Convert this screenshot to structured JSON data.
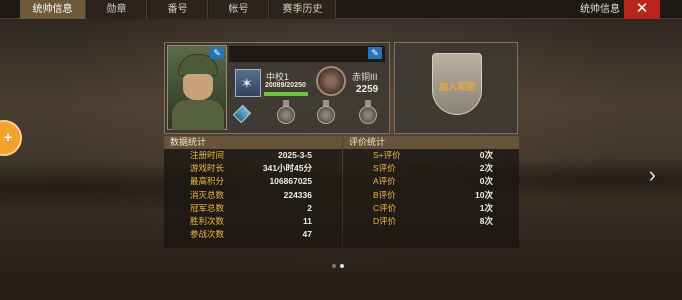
{
  "tabs": [
    {
      "label": "统帅信息",
      "active": true
    },
    {
      "label": "勋章",
      "active": false
    },
    {
      "label": "番号",
      "active": false
    },
    {
      "label": "帐号",
      "active": false
    },
    {
      "label": "赛季历史",
      "active": false
    }
  ],
  "header": {
    "title": "统帅信息",
    "close_icon": "close-icon"
  },
  "profile": {
    "rank": {
      "name": "中校1",
      "exp_text": "20089/20250",
      "exp_fraction": 0.992
    },
    "tier": {
      "name": "赤铜III",
      "score": "2259"
    }
  },
  "emblem": {
    "label": "加入军团"
  },
  "stats": {
    "title": "数据统计",
    "rows": [
      {
        "label": "注册时间",
        "value": "2025-3-5"
      },
      {
        "label": "游戏时长",
        "value": "341小时45分"
      },
      {
        "label": "最高积分",
        "value": "106867025"
      },
      {
        "label": "消灭总数",
        "value": "224336"
      },
      {
        "label": "冠军总数",
        "value": "2"
      },
      {
        "label": "胜利次数",
        "value": "11"
      },
      {
        "label": "参战次数",
        "value": "47"
      }
    ]
  },
  "ratings": {
    "title": "评价统计",
    "rows": [
      {
        "label": "S+评价",
        "value": "0次"
      },
      {
        "label": "S评价",
        "value": "2次"
      },
      {
        "label": "A评价",
        "value": "0次"
      },
      {
        "label": "B评价",
        "value": "10次"
      },
      {
        "label": "C评价",
        "value": "1次"
      },
      {
        "label": "D评价",
        "value": "8次"
      }
    ]
  },
  "colors": {
    "accent": "#f0b848",
    "close": "#b8251d",
    "exp": "#6ac63a"
  }
}
